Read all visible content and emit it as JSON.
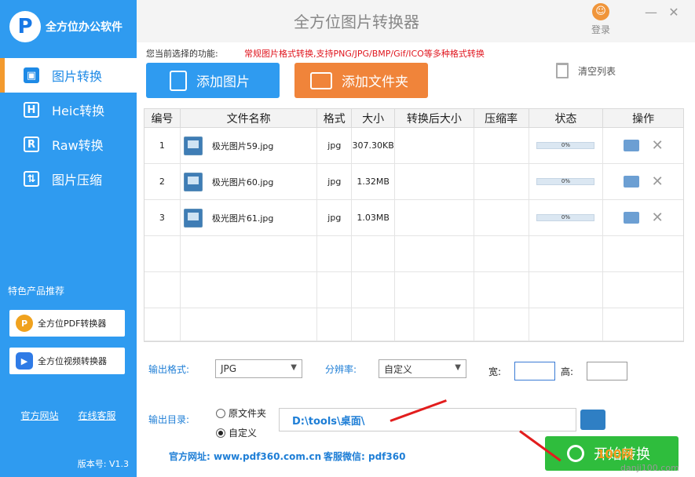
{
  "sidebar": {
    "logo_text": "全方位办公软件",
    "nav": [
      {
        "label": "图片转换",
        "icon": "image-icon",
        "active": true
      },
      {
        "label": "Heic转换",
        "icon": "heic-icon",
        "active": false
      },
      {
        "label": "Raw转换",
        "icon": "raw-icon",
        "active": false
      },
      {
        "label": "图片压缩",
        "icon": "compress-icon",
        "active": false
      }
    ],
    "rec_title": "特色产品推荐",
    "rec_items": [
      {
        "label": "全方位PDF转换器",
        "icon": "pdf-converter-icon"
      },
      {
        "label": "全方位视频转换器",
        "icon": "video-converter-icon"
      }
    ],
    "links": [
      "官方网站",
      "在线客服"
    ],
    "version": "版本号:  V1.3"
  },
  "titlebar": {
    "title": "全方位图片转换器",
    "login_label": "登录"
  },
  "function_line": {
    "label": "您当前选择的功能:",
    "desc": "常规图片格式转换,支持PNG/JPG/BMP/Gif/ICO等多种格式转换"
  },
  "toolbar": {
    "add_image": "添加图片",
    "add_folder": "添加文件夹",
    "clear_list": "清空列表"
  },
  "table": {
    "headers": [
      "编号",
      "文件名称",
      "格式",
      "大小",
      "转换后大小",
      "压缩率",
      "状态",
      "操作"
    ],
    "rows": [
      {
        "no": "1",
        "name": "极光图片59.jpg",
        "format": "jpg",
        "size": "307.30KB",
        "converted": "",
        "ratio": "",
        "progress": "0%"
      },
      {
        "no": "2",
        "name": "极光图片60.jpg",
        "format": "jpg",
        "size": "1.32MB",
        "converted": "",
        "ratio": "",
        "progress": "0%"
      },
      {
        "no": "3",
        "name": "极光图片61.jpg",
        "format": "jpg",
        "size": "1.03MB",
        "converted": "",
        "ratio": "",
        "progress": "0%"
      }
    ]
  },
  "settings": {
    "format_label": "输出格式:",
    "format_value": "JPG",
    "resolution_label": "分辨率:",
    "resolution_value": "自定义",
    "width_label": "宽:",
    "height_label": "高:",
    "dir_label": "输出目录:",
    "radio_original": "原文件夹",
    "radio_custom": "自定义",
    "dir_value": "D:\\tools\\桌面\\"
  },
  "footer": {
    "site": "官方网址: www.pdf360.com.cn",
    "wechat": "客服微信: pdf360",
    "start_button": "开始转换"
  },
  "watermark": {
    "line1": "100网",
    "line2": "danji100.com"
  },
  "colors": {
    "sidebar_bg": "#2f9bf0",
    "accent_orange": "#f0843a",
    "start_green": "#2fbd3d",
    "func_red": "#e0151e"
  }
}
